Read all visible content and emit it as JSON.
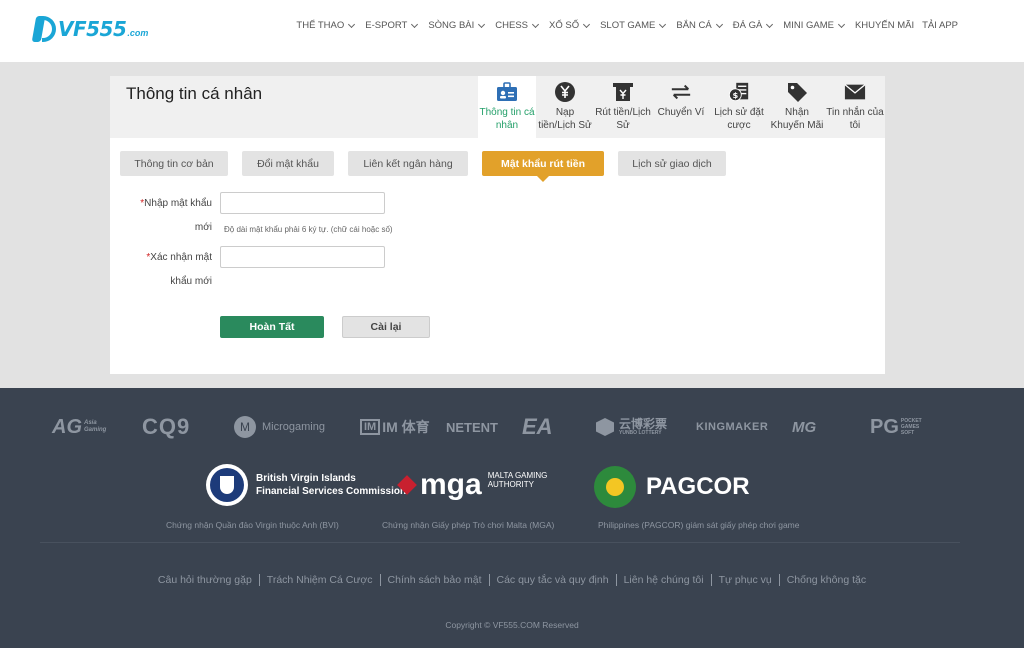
{
  "brand": {
    "name": "VF555",
    "domain": ".com",
    "color": "#1aa6d6"
  },
  "nav": [
    {
      "label": "THỂ THAO",
      "chevron": true
    },
    {
      "label": "E-SPORT",
      "chevron": true
    },
    {
      "label": "SÒNG BÀI",
      "chevron": true
    },
    {
      "label": "CHESS",
      "chevron": true
    },
    {
      "label": "XỔ SỐ",
      "chevron": true
    },
    {
      "label": "SLOT GAME",
      "chevron": true
    },
    {
      "label": "BẮN CÁ",
      "chevron": true
    },
    {
      "label": "ĐÁ GÀ",
      "chevron": true
    },
    {
      "label": "MINI GAME",
      "chevron": true
    },
    {
      "label": "KHUYẾN MÃI",
      "chevron": false
    },
    {
      "label": "TẢI APP",
      "chevron": false
    }
  ],
  "card": {
    "title": "Thông tin cá nhân",
    "tabs": [
      {
        "label": "Thông tin cá nhân",
        "icon": "id-card-icon",
        "active": true
      },
      {
        "label": "Nạp tiền/Lịch Sử",
        "icon": "yen-coin-icon",
        "active": false
      },
      {
        "label": "Rút tiền/Lịch Sử",
        "icon": "withdraw-icon",
        "active": false
      },
      {
        "label": "Chuyển Ví",
        "icon": "transfer-arrows-icon",
        "active": false
      },
      {
        "label": "Lịch sử đặt cược",
        "icon": "bet-history-icon",
        "active": false
      },
      {
        "label": "Nhận Khuyến Mãi",
        "icon": "tag-icon",
        "active": false
      },
      {
        "label": "Tin nhắn của tôi",
        "icon": "mail-icon",
        "active": false
      }
    ],
    "subtabs": [
      {
        "label": "Thông tin cơ bản",
        "active": false
      },
      {
        "label": "Đổi mật khẩu",
        "active": false
      },
      {
        "label": "Liên kết ngân hàng",
        "active": false
      },
      {
        "label": "Mật khẩu rút tiền",
        "active": true
      },
      {
        "label": "Lịch sử giao dịch",
        "active": false
      }
    ],
    "form": {
      "new_password_label_1": "Nhập mật khẩu",
      "new_password_label_2": "mới",
      "new_password_value": "",
      "hint": "Độ dài mật khẩu phải 6 ký tự. (chữ cái hoặc số)",
      "confirm_label_1": "Xác nhận mật",
      "confirm_label_2": "khẩu mới",
      "confirm_value": "",
      "required_mark": "*",
      "submit": "Hoàn Tất",
      "reset": "Cài lại"
    }
  },
  "footer": {
    "partners": [
      "AG",
      "CQ9",
      "Microgaming",
      "IM 体育",
      "NETENT",
      "EA",
      "云博彩票",
      "KINGMAKER",
      "MG",
      "PG"
    ],
    "partner_subtexts": {
      "ag": "Asia Gaming",
      "pg": "POCKET GAMES SOFT",
      "yunbo": "YUNBO LOTTERY"
    },
    "licenses": [
      {
        "name_line1": "British Virgin Islands",
        "name_line2": "Financial Services Commission",
        "caption": "Chứng nhận Quần đảo Virgin thuộc Anh (BVI)"
      },
      {
        "name": "mga",
        "sub_line1": "MALTA GAMING",
        "sub_line2": "AUTHORITY",
        "caption": "Chứng nhận Giấy phép Trò chơi Malta (MGA)"
      },
      {
        "name": "PAGCOR",
        "caption": "Philippines (PAGCOR) giám sát giấy phép chơi game"
      }
    ],
    "links": [
      "Câu hỏi thường gặp",
      "Trách Nhiệm Cá Cược",
      "Chính sách bảo mật",
      "Các quy tắc và quy định",
      "Liên hệ chúng tôi",
      "Tự phục vụ",
      "Chống không tặc"
    ],
    "copyright": "Copyright © VF555.COM Reserved"
  },
  "colors": {
    "accent_green": "#25a06a",
    "submit_green": "#2a8a5d",
    "active_orange": "#e2a12a",
    "footer_bg": "#3a4350"
  }
}
